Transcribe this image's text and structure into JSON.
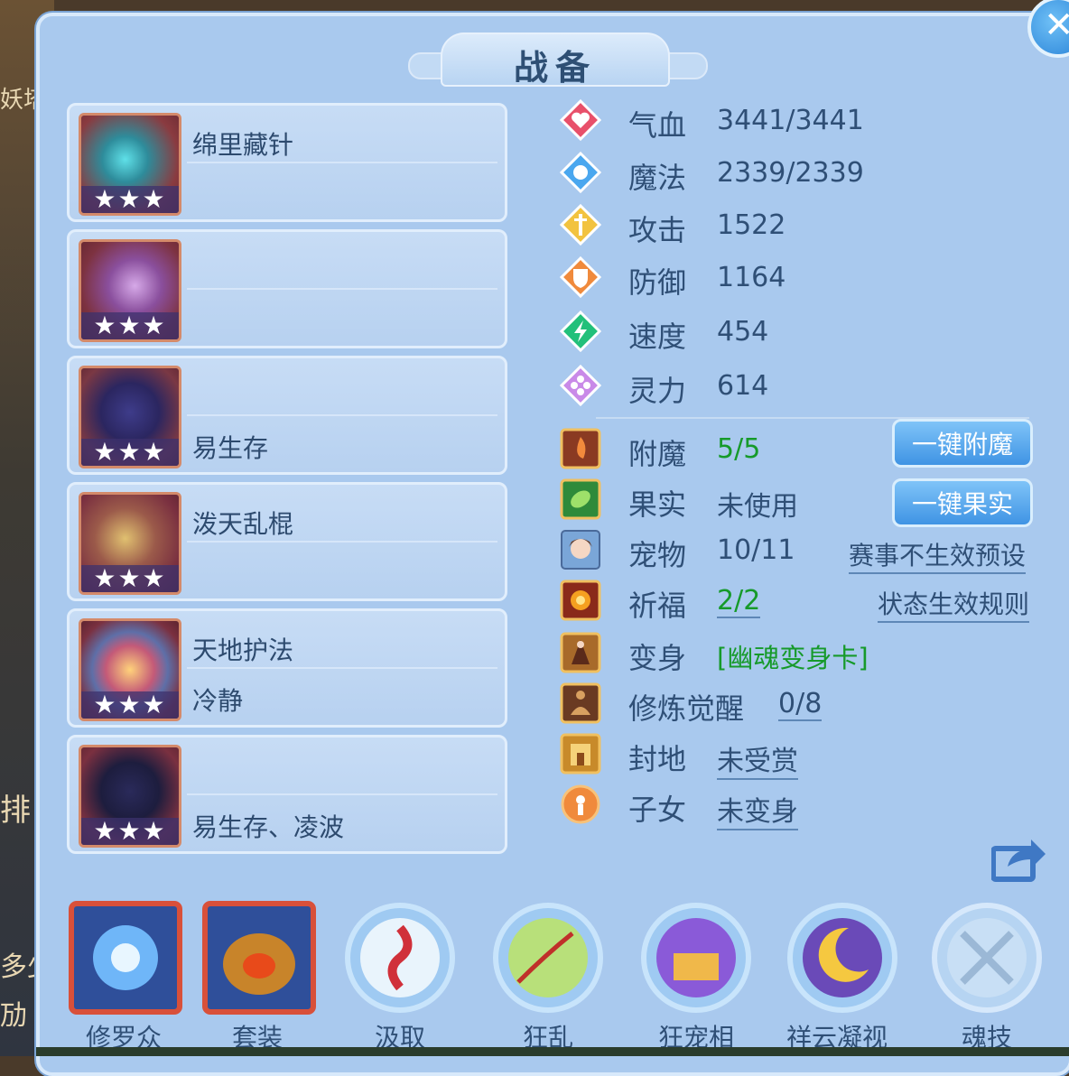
{
  "title": "战备",
  "background_left": {
    "t1": "妖塔",
    "t2": "排",
    "t3": "多少",
    "t4": "劢"
  },
  "equipment": [
    {
      "line1": "绵里藏针",
      "line2": "",
      "stars": "★★★"
    },
    {
      "line1": "",
      "line2": "",
      "stars": "★★★"
    },
    {
      "line1": "",
      "line2": "易生存",
      "stars": "★★★"
    },
    {
      "line1": "泼天乱棍",
      "line2": "",
      "stars": "★★★"
    },
    {
      "line1": "天地护法",
      "line2": "冷静",
      "stars": "★★★"
    },
    {
      "line1": "",
      "line2": "易生存、凌波",
      "stars": "★★★"
    }
  ],
  "stats": [
    {
      "label": "气血",
      "value": "3441/3441",
      "icon": "heart-icon",
      "color": "#e8506a"
    },
    {
      "label": "魔法",
      "value": "2339/2339",
      "icon": "magic-icon",
      "color": "#4aa7ef"
    },
    {
      "label": "攻击",
      "value": "1522",
      "icon": "sword-icon",
      "color": "#f2c340"
    },
    {
      "label": "防御",
      "value": "1164",
      "icon": "shield-icon",
      "color": "#f08a3c"
    },
    {
      "label": "速度",
      "value": "454",
      "icon": "lightning-icon",
      "color": "#22c07a"
    },
    {
      "label": "灵力",
      "value": "614",
      "icon": "spirit-icon",
      "color": "#c98ae8"
    }
  ],
  "features": {
    "enchant": {
      "label": "附魔",
      "value": "5/5",
      "button": "一键附魔"
    },
    "fruit": {
      "label": "果实",
      "value": "未使用",
      "button": "一键果实"
    },
    "pet": {
      "label": "宠物",
      "value": "10/11",
      "link": "赛事不生效预设"
    },
    "blessing": {
      "label": "祈福",
      "value": "2/2",
      "link": "状态生效规则"
    },
    "transform": {
      "label": "变身",
      "value": "[幽魂变身卡]"
    },
    "cultivation": {
      "label": "修炼觉醒",
      "value": "0/8"
    },
    "fief": {
      "label": "封地",
      "value": "未受赏"
    },
    "children": {
      "label": "子女",
      "value": "未变身"
    }
  },
  "bottom": [
    {
      "label": "修罗众",
      "icon": "shura-orb-icon"
    },
    {
      "label": "套装",
      "icon": "treasure-pot-icon"
    },
    {
      "label": "汲取",
      "icon": "spiral-orb-icon"
    },
    {
      "label": "狂乱",
      "icon": "vine-orb-icon"
    },
    {
      "label": "狂宠相",
      "icon": "chest-orb-icon"
    },
    {
      "label": "祥云凝视",
      "icon": "moon-orb-icon"
    },
    {
      "label": "魂技",
      "icon": "locked-orb-icon"
    }
  ]
}
